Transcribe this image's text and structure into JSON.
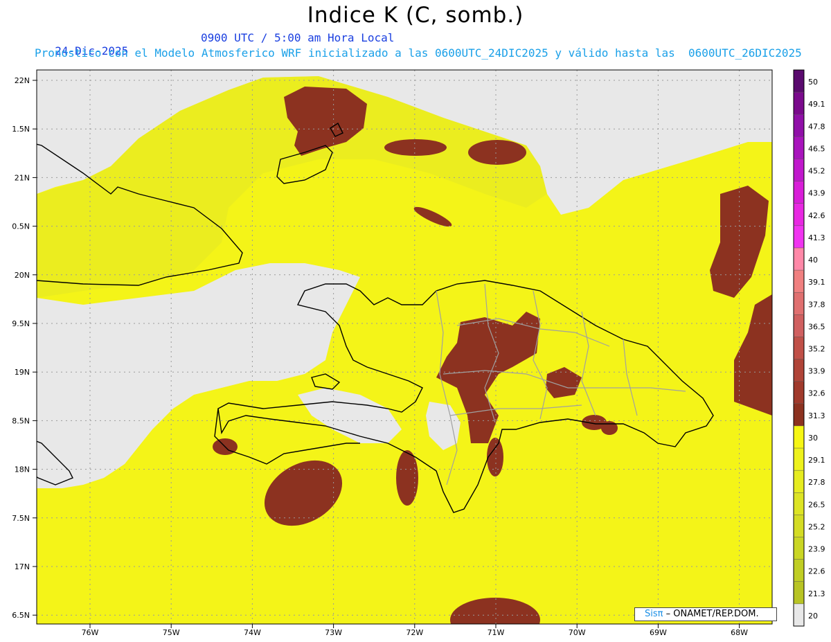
{
  "title": "Indice K (C, somb.)",
  "date": "24-Dic-2025",
  "time": "0900 UTC / 5:00 am Hora Local",
  "forecast_line": "Pronostico con el Modelo Atmosferico WRF inicializado a las 0600UTC_24DIC2025 y válido hasta las  0600UTC_26DIC2025",
  "credit": {
    "brand": "Sisπ",
    "text": " – ONAMET/REP.DOM."
  },
  "lat_labels": [
    "22N",
    "1.5N",
    "21N",
    "0.5N",
    "20N",
    "9.5N",
    "19N",
    "8.5N",
    "18N",
    "7.5N",
    "17N",
    "6.5N"
  ],
  "lon_labels": [
    "76W",
    "75W",
    "74W",
    "73W",
    "72W",
    "71W",
    "70W",
    "69W",
    "68W"
  ],
  "colorbar": {
    "labels": [
      "50",
      "49.1",
      "47.8",
      "46.5",
      "45.2",
      "43.9",
      "42.6",
      "41.3",
      "40",
      "39.1",
      "37.8",
      "36.5",
      "35.2",
      "33.9",
      "32.6",
      "31.3",
      "30",
      "29.1",
      "27.8",
      "26.5",
      "25.2",
      "23.9",
      "22.6",
      "21.3",
      "20"
    ],
    "colors": [
      "#5a0a6e",
      "#7a0a8c",
      "#9010a8",
      "#a814bc",
      "#c018cc",
      "#d81ed8",
      "#e828e2",
      "#f034f0",
      "#ff88a8",
      "#f08080",
      "#e07070",
      "#d06060",
      "#c05048",
      "#b04438",
      "#a03a2c",
      "#8c3220",
      "#f6f614",
      "#eef21c",
      "#e6ec20",
      "#dde424",
      "#d4dc24",
      "#cad624",
      "#c0ce24",
      "#b8c424",
      "#e8e8e8"
    ]
  },
  "colors": {
    "land_low": "#e8e8e8",
    "k_26": "#e6ec20",
    "k_30": "#f6f614",
    "k_31": "#8c3220",
    "coast": "#000000",
    "borders": "#a0a0a0"
  }
}
